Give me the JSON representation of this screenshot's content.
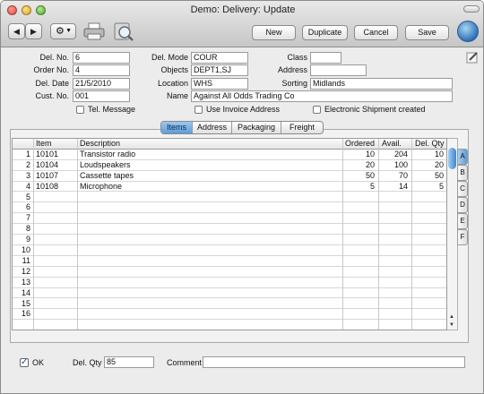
{
  "window": {
    "title": "Demo: Delivery: Update"
  },
  "toolbar": {
    "new_label": "New",
    "duplicate_label": "Duplicate",
    "cancel_label": "Cancel",
    "save_label": "Save",
    "prev_glyph": "◀",
    "next_glyph": "▶",
    "gear_glyph": "⚙",
    "dropdown_glyph": "▼"
  },
  "header": {
    "del_no": {
      "label": "Del. No.",
      "value": "6"
    },
    "order_no": {
      "label": "Order No.",
      "value": "4"
    },
    "del_date": {
      "label": "Del. Date",
      "value": "21/5/2010"
    },
    "cust_no": {
      "label": "Cust. No.",
      "value": "001"
    },
    "del_mode": {
      "label": "Del. Mode",
      "value": "COUR"
    },
    "objects": {
      "label": "Objects",
      "value": "DEPT1,SJ"
    },
    "location": {
      "label": "Location",
      "value": "WHS"
    },
    "name": {
      "label": "Name",
      "value": "Against All Odds Trading Co"
    },
    "class": {
      "label": "Class",
      "value": ""
    },
    "address": {
      "label": "Address",
      "value": ""
    },
    "sorting": {
      "label": "Sorting",
      "value": "Midlands"
    },
    "tel_message": {
      "label": "Tel. Message",
      "checked": false
    },
    "use_invoice_address": {
      "label": "Use Invoice Address",
      "checked": false
    },
    "electronic_shipment": {
      "label": "Electronic Shipment created",
      "checked": false
    }
  },
  "tabs": [
    {
      "label": "Items",
      "active": true
    },
    {
      "label": "Address",
      "active": false
    },
    {
      "label": "Packaging",
      "active": false
    },
    {
      "label": "Freight",
      "active": false
    }
  ],
  "table": {
    "columns": {
      "item": "Item",
      "description": "Description",
      "ordered": "Ordered",
      "avail": "Avail.",
      "del_qty": "Del. Qty"
    },
    "rows": [
      {
        "n": "1",
        "item": "10101",
        "description": "Transistor radio",
        "ordered": "10",
        "avail": "204",
        "del_qty": "10"
      },
      {
        "n": "2",
        "item": "10104",
        "description": "Loudspeakers",
        "ordered": "20",
        "avail": "100",
        "del_qty": "20"
      },
      {
        "n": "3",
        "item": "10107",
        "description": "Cassette tapes",
        "ordered": "50",
        "avail": "70",
        "del_qty": "50"
      },
      {
        "n": "4",
        "item": "10108",
        "description": "Microphone",
        "ordered": "5",
        "avail": "14",
        "del_qty": "5"
      },
      {
        "n": "5",
        "item": "",
        "description": "",
        "ordered": "",
        "avail": "",
        "del_qty": ""
      },
      {
        "n": "6",
        "item": "",
        "description": "",
        "ordered": "",
        "avail": "",
        "del_qty": ""
      },
      {
        "n": "7",
        "item": "",
        "description": "",
        "ordered": "",
        "avail": "",
        "del_qty": ""
      },
      {
        "n": "8",
        "item": "",
        "description": "",
        "ordered": "",
        "avail": "",
        "del_qty": ""
      },
      {
        "n": "9",
        "item": "",
        "description": "",
        "ordered": "",
        "avail": "",
        "del_qty": ""
      },
      {
        "n": "10",
        "item": "",
        "description": "",
        "ordered": "",
        "avail": "",
        "del_qty": ""
      },
      {
        "n": "11",
        "item": "",
        "description": "",
        "ordered": "",
        "avail": "",
        "del_qty": ""
      },
      {
        "n": "12",
        "item": "",
        "description": "",
        "ordered": "",
        "avail": "",
        "del_qty": ""
      },
      {
        "n": "13",
        "item": "",
        "description": "",
        "ordered": "",
        "avail": "",
        "del_qty": ""
      },
      {
        "n": "14",
        "item": "",
        "description": "",
        "ordered": "",
        "avail": "",
        "del_qty": ""
      },
      {
        "n": "15",
        "item": "",
        "description": "",
        "ordered": "",
        "avail": "",
        "del_qty": ""
      },
      {
        "n": "16",
        "item": "",
        "description": "",
        "ordered": "",
        "avail": "",
        "del_qty": ""
      }
    ]
  },
  "row_letters": [
    "A",
    "B",
    "C",
    "D",
    "E",
    "F"
  ],
  "footer": {
    "ok_label": "OK",
    "ok_checked": true,
    "del_qty_label": "Del. Qty",
    "del_qty_value": "85",
    "comment_label": "Comment",
    "comment_value": ""
  },
  "colors": {
    "tab_active": "#5e9bd8",
    "thumb": "#3f86cf"
  }
}
